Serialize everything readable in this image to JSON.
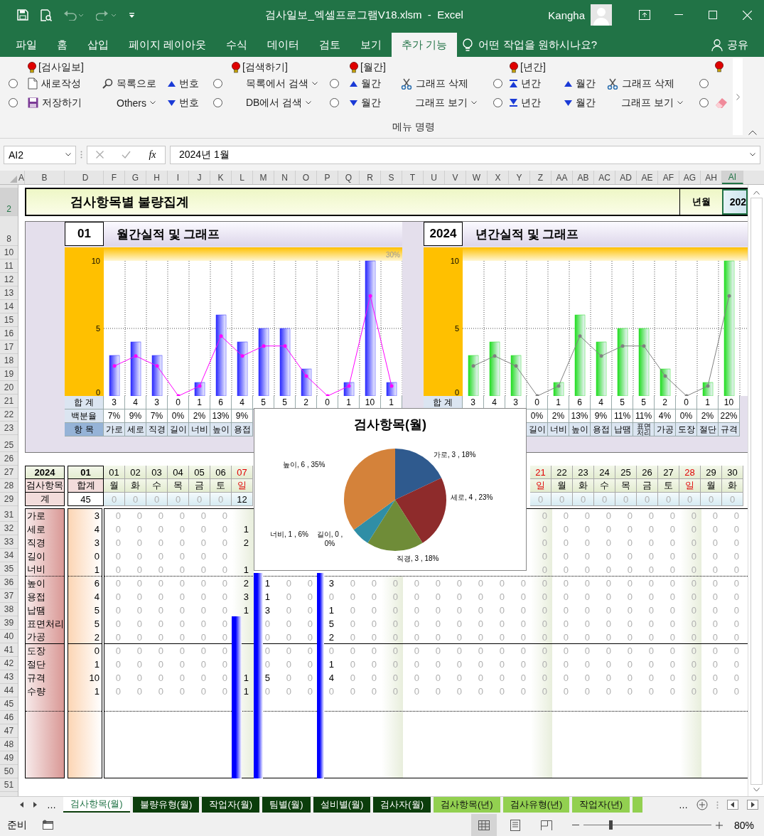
{
  "title_bar": {
    "title": "검사일보_엑셀프로그램V18.xlsm  -  Excel",
    "user": "Kangha"
  },
  "menu_tabs": [
    {
      "label": "파일",
      "selected": false
    },
    {
      "label": "홈",
      "selected": false
    },
    {
      "label": "삽입",
      "selected": false
    },
    {
      "label": "페이지 레이아웃",
      "selected": false
    },
    {
      "label": "수식",
      "selected": false
    },
    {
      "label": "데이터",
      "selected": false
    },
    {
      "label": "검토",
      "selected": false
    },
    {
      "label": "보기",
      "selected": false
    },
    {
      "label": "추가 기능",
      "selected": true
    }
  ],
  "tell_me": "어떤 작업을 원하시나요?",
  "share": "공유",
  "ribbon": {
    "group_label": "메뉴 명령",
    "columns": [
      {
        "controls": [
          {
            "kind": "radio",
            "selected": false
          },
          {
            "kind": "radio",
            "selected": false
          }
        ]
      },
      {
        "header": "[검사일보]",
        "header_icon": true,
        "controls": [
          {
            "kind": "new",
            "label": "새로작성"
          },
          {
            "kind": "save",
            "label": "저장하기"
          }
        ]
      },
      {
        "controls": [
          {
            "kind": "list",
            "label": "목록으로"
          },
          {
            "kind": "menu",
            "label": "Others"
          }
        ]
      },
      {
        "controls": [
          {
            "kind": "up",
            "label": "번호"
          },
          {
            "kind": "down",
            "label": "번호"
          }
        ]
      },
      {
        "controls": [
          {
            "kind": "radio",
            "selected": false
          },
          {
            "kind": "radio",
            "selected": false
          }
        ]
      },
      {
        "header": "[검색하기]",
        "header_icon": true,
        "controls": [
          {
            "kind": "menu",
            "label": "목록에서 검색"
          },
          {
            "kind": "menu",
            "label": "DB에서 검색"
          }
        ]
      },
      {
        "controls": [
          {
            "kind": "radio",
            "selected": false
          },
          {
            "kind": "radio",
            "selected": false
          }
        ]
      },
      {
        "header": "[월간]",
        "header_icon": true,
        "controls": [
          {
            "kind": "up",
            "label": "월간"
          },
          {
            "kind": "down",
            "label": "월간"
          }
        ]
      },
      {
        "controls": [
          {
            "kind": "cut",
            "label": "그래프 삭제"
          },
          {
            "kind": "menu",
            "label": "그래프 보기"
          }
        ]
      },
      {
        "controls": [
          {
            "kind": "radio",
            "selected": false
          },
          {
            "kind": "radio",
            "selected": false
          }
        ]
      },
      {
        "header": "[년간]",
        "header_icon": true,
        "controls": [
          {
            "kind": "first",
            "label": "년간"
          },
          {
            "kind": "last",
            "label": "년간"
          }
        ]
      },
      {
        "controls": [
          {
            "kind": "up",
            "label": "월간"
          },
          {
            "kind": "down",
            "label": "월간"
          }
        ]
      },
      {
        "controls": [
          {
            "kind": "cut",
            "label": "그래프 삭제"
          },
          {
            "kind": "menu",
            "label": "그래프 보기"
          }
        ]
      },
      {
        "controls": [
          {
            "kind": "radio",
            "selected": false
          },
          {
            "kind": "radio",
            "selected": false
          }
        ]
      },
      {
        "header_icon": true,
        "controls": [
          {
            "kind": "clear"
          }
        ]
      }
    ]
  },
  "formula_bar": {
    "name_box": "AI2",
    "function_label": "fx",
    "value": "2024년 1월"
  },
  "column_headers": [
    {
      "label": "A",
      "selected": false
    },
    {
      "label": "B",
      "selected": false
    },
    {
      "label": "D",
      "selected": false
    },
    {
      "label": "F",
      "selected": false
    },
    {
      "label": "G",
      "selected": false
    },
    {
      "label": "H",
      "selected": false
    },
    {
      "label": "I",
      "selected": false
    },
    {
      "label": "J",
      "selected": false
    },
    {
      "label": "K",
      "selected": false
    },
    {
      "label": "L",
      "selected": false
    },
    {
      "label": "M",
      "selected": false
    },
    {
      "label": "N",
      "selected": false
    },
    {
      "label": "O",
      "selected": false
    },
    {
      "label": "P",
      "selected": false
    },
    {
      "label": "Q",
      "selected": false
    },
    {
      "label": "R",
      "selected": false
    },
    {
      "label": "S",
      "selected": false
    },
    {
      "label": "T",
      "selected": false
    },
    {
      "label": "U",
      "selected": false
    },
    {
      "label": "V",
      "selected": false
    },
    {
      "label": "W",
      "selected": false
    },
    {
      "label": "X",
      "selected": false
    },
    {
      "label": "Y",
      "selected": false
    },
    {
      "label": "Z",
      "selected": false
    },
    {
      "label": "AA",
      "selected": false
    },
    {
      "label": "AB",
      "selected": false
    },
    {
      "label": "AC",
      "selected": false
    },
    {
      "label": "AD",
      "selected": false
    },
    {
      "label": "AE",
      "selected": false
    },
    {
      "label": "AF",
      "selected": false
    },
    {
      "label": "AG",
      "selected": false
    },
    {
      "label": "AH",
      "selected": false
    },
    {
      "label": "AI",
      "selected": true
    }
  ],
  "row_headers": [
    {
      "label": "2",
      "selected": true
    },
    {
      "label": "8",
      "selected": false
    },
    {
      "label": "10",
      "selected": false
    },
    {
      "label": "11",
      "selected": false
    },
    {
      "label": "12",
      "selected": false
    },
    {
      "label": "13",
      "selected": false
    },
    {
      "label": "14",
      "selected": false
    },
    {
      "label": "15",
      "selected": false
    },
    {
      "label": "16",
      "selected": false
    },
    {
      "label": "17",
      "selected": false
    },
    {
      "label": "18",
      "selected": false
    },
    {
      "label": "19",
      "selected": false
    },
    {
      "label": "20",
      "selected": false
    },
    {
      "label": "21",
      "selected": false
    },
    {
      "label": "22",
      "selected": false
    },
    {
      "label": "23",
      "selected": false
    },
    {
      "label": "25",
      "selected": false
    },
    {
      "label": "26",
      "selected": false
    },
    {
      "label": "27",
      "selected": false
    },
    {
      "label": "28",
      "selected": false
    },
    {
      "label": "29",
      "selected": false
    },
    {
      "label": "31",
      "selected": false
    },
    {
      "label": "32",
      "selected": false
    },
    {
      "label": "33",
      "selected": false
    },
    {
      "label": "34",
      "selected": false
    },
    {
      "label": "35",
      "selected": false
    },
    {
      "label": "36",
      "selected": false
    },
    {
      "label": "37",
      "selected": false
    },
    {
      "label": "38",
      "selected": false
    },
    {
      "label": "39",
      "selected": false
    },
    {
      "label": "40",
      "selected": false
    },
    {
      "label": "41",
      "selected": false
    },
    {
      "label": "42",
      "selected": false
    },
    {
      "label": "43",
      "selected": false
    },
    {
      "label": "44",
      "selected": false
    },
    {
      "label": "45",
      "selected": false
    },
    {
      "label": "46",
      "selected": false
    },
    {
      "label": "47",
      "selected": false
    },
    {
      "label": "48",
      "selected": false
    },
    {
      "label": "49",
      "selected": false
    },
    {
      "label": "50",
      "selected": false
    },
    {
      "label": "51",
      "selected": false
    }
  ],
  "banner": {
    "title": "검사항목별 불량집계",
    "period_label": "년월",
    "period_value": "202"
  },
  "monthly": {
    "period": "01",
    "title": "월간실적 및 그래프",
    "chart_data": {
      "type": "bar",
      "ylim": [
        0,
        10
      ],
      "yticks": [
        0,
        5,
        10
      ],
      "grid": true,
      "annotations": [
        {
          "text": "30%"
        }
      ],
      "series": [
        {
          "type": "bar",
          "color": "#2a2aff",
          "values": [
            3,
            4,
            3,
            0,
            1,
            6,
            4,
            5,
            5,
            2,
            0,
            1,
            10,
            1
          ]
        },
        {
          "type": "line",
          "color": "#ff00ff",
          "values": [
            2.22,
            2.96,
            2.22,
            0,
            0.74,
            4.44,
            2.96,
            3.7,
            3.7,
            1.48,
            0,
            0.74,
            7.41,
            0.74
          ]
        }
      ]
    },
    "rows": [
      {
        "label": "합 계",
        "cells": [
          "3",
          "4",
          "3",
          "0",
          "1",
          "6",
          "4",
          "5",
          "5",
          "2",
          "0",
          "1",
          "10",
          "1"
        ]
      },
      {
        "label": "백분율",
        "cells": [
          "7%",
          "9%",
          "7%",
          "0%",
          "2%",
          "13%",
          "9%",
          null,
          null,
          null,
          null,
          null,
          null,
          null
        ]
      },
      {
        "label": "항 목",
        "cells": [
          "가로",
          "세로",
          "직경",
          "길이",
          "너비",
          "높이",
          "용접",
          null,
          null,
          null,
          null,
          null,
          null,
          null
        ]
      }
    ]
  },
  "yearly": {
    "period": "2024",
    "title": "년간실적 및 그래프",
    "chart_data": {
      "type": "bar",
      "ylim": [
        0,
        10
      ],
      "yticks": [
        0,
        5,
        10
      ],
      "grid": true,
      "series": [
        {
          "type": "bar",
          "color": "#22dd22",
          "values": [
            3,
            4,
            3,
            0,
            1,
            6,
            4,
            5,
            5,
            2,
            0,
            1,
            10
          ]
        },
        {
          "type": "line",
          "color": "#808080",
          "values": [
            2.22,
            2.96,
            2.22,
            0,
            0.74,
            4.44,
            2.96,
            3.7,
            3.7,
            1.48,
            0,
            0.74,
            7.41
          ]
        }
      ]
    },
    "rows": [
      {
        "label": "합 계",
        "cells": [
          "3",
          "4",
          "3",
          "0",
          "1",
          "6",
          "4",
          "5",
          "5",
          "2",
          "0",
          "1",
          "10",
          null
        ]
      },
      {
        "cells": [
          null,
          null,
          null,
          "0%",
          "2%",
          "13%",
          "9%",
          "11%",
          "11%",
          "4%",
          "0%",
          "2%",
          "22%",
          null
        ]
      },
      {
        "cells": [
          null,
          null,
          null,
          "길이",
          "너비",
          "높이",
          "용접",
          "납땜",
          "표면처리",
          "가공",
          "도장",
          "절단",
          "규격",
          null
        ]
      }
    ]
  },
  "pie": {
    "chart_data": {
      "type": "pie",
      "title": "검사항목(월)",
      "series": [
        {
          "values": [
            18,
            23,
            18,
            0,
            6,
            35
          ]
        }
      ],
      "colors": [
        "#2f5a8e",
        "#8e2b2b",
        "#6f8c38",
        "#4c3a6e",
        "#2f8ea6",
        "#d4823a"
      ],
      "value_labels": [
        "가로, 3 , 18%",
        "세로, 4 , 23%",
        "직경, 3 , 18%",
        "길이, 0 , 0%",
        "너비, 1 , 6%",
        "높이, 6 , 35%"
      ]
    }
  },
  "daily": {
    "year": "2024",
    "month": "01",
    "item_header": "검사항목",
    "total_header": "합계",
    "sum_label": "계",
    "grand_total": "45",
    "days": [
      {
        "day": "01",
        "weekday": "월",
        "holiday": false,
        "total": "0"
      },
      {
        "day": "02",
        "weekday": "화",
        "holiday": false,
        "total": "0"
      },
      {
        "day": "03",
        "weekday": "수",
        "holiday": false,
        "total": "0"
      },
      {
        "day": "04",
        "weekday": "목",
        "holiday": false,
        "total": "0"
      },
      {
        "day": "05",
        "weekday": "금",
        "holiday": false,
        "total": "0"
      },
      {
        "day": "06",
        "weekday": "토",
        "holiday": false,
        "total": "0"
      },
      {
        "day": "07",
        "weekday": "일",
        "holiday": true,
        "total": "12"
      },
      {
        "holiday": false
      },
      {
        "holiday": false
      },
      {
        "holiday": false
      },
      {
        "holiday": false
      },
      {
        "holiday": false
      },
      {
        "holiday": false
      },
      {
        "holiday": true
      },
      {
        "holiday": false
      },
      {
        "holiday": false
      },
      {
        "holiday": false
      },
      {
        "holiday": false
      },
      {
        "holiday": false
      },
      {
        "holiday": false
      },
      {
        "day": "21",
        "weekday": "일",
        "holiday": true,
        "total": "0"
      },
      {
        "day": "22",
        "weekday": "월",
        "holiday": false,
        "total": "0"
      },
      {
        "day": "23",
        "weekday": "화",
        "holiday": false,
        "total": "0"
      },
      {
        "day": "24",
        "weekday": "수",
        "holiday": false,
        "total": "0"
      },
      {
        "day": "25",
        "weekday": "목",
        "holiday": false,
        "total": "0"
      },
      {
        "day": "26",
        "weekday": "금",
        "holiday": false,
        "total": "0"
      },
      {
        "day": "27",
        "weekday": "토",
        "holiday": false,
        "total": "0"
      },
      {
        "day": "28",
        "weekday": "일",
        "holiday": true,
        "total": "0"
      },
      {
        "day": "29",
        "weekday": "월",
        "holiday": false,
        "total": "0"
      },
      {
        "day": "30",
        "weekday": "화",
        "holiday": false,
        "total": "0"
      }
    ],
    "rows": [
      {
        "item": "가로",
        "total": "3",
        "cells": [
          "0",
          "0",
          "0",
          "0",
          "0",
          "0",
          null,
          null,
          null,
          null,
          null,
          null,
          null,
          null,
          null,
          null,
          null,
          null,
          null,
          null,
          "0",
          "0",
          "0",
          "0",
          "0",
          "0",
          "0",
          "0",
          "0",
          "0"
        ]
      },
      {
        "item": "세로",
        "total": "4",
        "cells": [
          "0",
          "0",
          "0",
          "0",
          "0",
          "0",
          "1",
          null,
          null,
          null,
          null,
          null,
          null,
          null,
          null,
          null,
          null,
          null,
          null,
          null,
          "0",
          "0",
          "0",
          "0",
          "0",
          "0",
          "0",
          "0",
          "0",
          "0"
        ]
      },
      {
        "item": "직경",
        "total": "3",
        "cells": [
          "0",
          "0",
          "0",
          "0",
          "0",
          "0",
          "2",
          null,
          null,
          null,
          null,
          null,
          null,
          null,
          null,
          null,
          null,
          null,
          null,
          null,
          "0",
          "0",
          "0",
          "0",
          "0",
          "0",
          "0",
          "0",
          "0",
          "0"
        ]
      },
      {
        "item": "길이",
        "total": "0",
        "cells": [
          "0",
          "0",
          "0",
          "0",
          "0",
          "0",
          null,
          null,
          null,
          null,
          null,
          null,
          null,
          null,
          null,
          null,
          null,
          null,
          null,
          null,
          "0",
          "0",
          "0",
          "0",
          "0",
          "0",
          "0",
          "0",
          "0",
          "0"
        ]
      },
      {
        "item": "너비",
        "total": "1",
        "cells": [
          "0",
          "0",
          "0",
          "0",
          "0",
          "0",
          "1",
          null,
          null,
          null,
          null,
          null,
          null,
          null,
          null,
          null,
          null,
          null,
          null,
          null,
          "0",
          "0",
          "0",
          "0",
          "0",
          "0",
          "0",
          "0",
          "0",
          "0"
        ]
      },
      {
        "item": "높이",
        "total": "6",
        "cells": [
          "0",
          "0",
          "0",
          "0",
          "0",
          "0",
          "2",
          "1",
          "0",
          "0",
          "3",
          "0",
          "0",
          "0",
          "0",
          "0",
          "0",
          "0",
          "0",
          "0",
          "0",
          "0",
          "0",
          "0",
          "0",
          "0",
          "0",
          "0",
          "0",
          "0"
        ]
      },
      {
        "item": "용접",
        "total": "4",
        "cells": [
          "0",
          "0",
          "0",
          "0",
          "0",
          "0",
          "3",
          "1",
          "0",
          "0",
          "0",
          "0",
          "0",
          "0",
          "0",
          "0",
          "0",
          "0",
          "0",
          "0",
          "0",
          "0",
          "0",
          "0",
          "0",
          "0",
          "0",
          "0",
          "0",
          "0"
        ]
      },
      {
        "item": "납땜",
        "total": "5",
        "cells": [
          "0",
          "0",
          "0",
          "0",
          "0",
          "0",
          "1",
          "3",
          "0",
          "0",
          "1",
          "0",
          "0",
          "0",
          "0",
          "0",
          "0",
          "0",
          "0",
          "0",
          "0",
          "0",
          "0",
          "0",
          "0",
          "0",
          "0",
          "0",
          "0",
          "0"
        ]
      },
      {
        "item": "표면처리",
        "total": "5",
        "cells": [
          "0",
          "0",
          "0",
          "0",
          "0",
          "0",
          null,
          "0",
          "0",
          "0",
          "5",
          "0",
          "0",
          "0",
          "0",
          "0",
          "0",
          "0",
          "0",
          "0",
          "0",
          "0",
          "0",
          "0",
          "0",
          "0",
          "0",
          "0",
          "0",
          "0"
        ]
      },
      {
        "item": "가공",
        "total": "2",
        "cells": [
          "0",
          "0",
          "0",
          "0",
          "0",
          "0",
          null,
          "0",
          "0",
          "0",
          "2",
          "0",
          "0",
          "0",
          "0",
          "0",
          "0",
          "0",
          "0",
          "0",
          "0",
          "0",
          "0",
          "0",
          "0",
          "0",
          "0",
          "0",
          "0",
          "0"
        ]
      },
      {
        "item": "도장",
        "total": "0",
        "cells": [
          "0",
          "0",
          "0",
          "0",
          "0",
          "0",
          null,
          "0",
          "0",
          "0",
          "0",
          "0",
          "0",
          "0",
          "0",
          "0",
          "0",
          "0",
          "0",
          "0",
          "0",
          "0",
          "0",
          "0",
          "0",
          "0",
          "0",
          "0",
          "0",
          "0"
        ]
      },
      {
        "item": "절단",
        "total": "1",
        "cells": [
          "0",
          "0",
          "0",
          "0",
          "0",
          "0",
          null,
          "0",
          "0",
          "0",
          "1",
          "0",
          "0",
          "0",
          "0",
          "0",
          "0",
          "0",
          "0",
          "0",
          "0",
          "0",
          "0",
          "0",
          "0",
          "0",
          "0",
          "0",
          "0",
          "0"
        ]
      },
      {
        "item": "규격",
        "total": "10",
        "cells": [
          "0",
          "0",
          "0",
          "0",
          "0",
          "0",
          "1",
          "5",
          "0",
          "0",
          "4",
          "0",
          "0",
          "0",
          "0",
          "0",
          "0",
          "0",
          "0",
          "0",
          "0",
          "0",
          "0",
          "0",
          "0",
          "0",
          "0",
          "0",
          "0",
          "0"
        ]
      },
      {
        "item": "수량",
        "total": "1",
        "cells": [
          "0",
          "0",
          "0",
          "0",
          "0",
          "0",
          "1",
          "0",
          "0",
          "0",
          "0",
          "0",
          "0",
          "0",
          "0",
          "0",
          "0",
          "0",
          "0",
          "0",
          "0",
          "0",
          "0",
          "0",
          "0",
          "0",
          "0",
          "0",
          "0",
          "0"
        ]
      }
    ]
  },
  "sheet_tabs": {
    "more_left": "…",
    "more_right": "…",
    "tabs": [
      {
        "label": "검사항목(월)",
        "selected": true,
        "color": "#0b3d0b"
      },
      {
        "label": "불량유형(월)",
        "selected": false,
        "color": "#0b3d0b"
      },
      {
        "label": "작업자(월)",
        "selected": false,
        "color": "#0b3d0b"
      },
      {
        "label": "팀별(월)",
        "selected": false,
        "color": "#0b3d0b"
      },
      {
        "label": "설비별(월)",
        "selected": false,
        "color": "#0b3d0b"
      },
      {
        "label": "검사자(월)",
        "selected": false,
        "color": "#0b3d0b"
      },
      {
        "label": "검사항목(년)",
        "selected": false,
        "color": "#92d050"
      },
      {
        "label": "검사유형(년)",
        "selected": false,
        "color": "#92d050"
      },
      {
        "label": "작업자(년)",
        "selected": false,
        "color": "#92d050"
      },
      {
        "selected": false,
        "color": "#92d050"
      }
    ]
  },
  "status_bar": {
    "text": "준비",
    "views": [
      {
        "kind": "normal",
        "selected": true
      },
      {
        "kind": "page",
        "selected": false
      },
      {
        "kind": "break",
        "selected": false
      }
    ],
    "zoom": {
      "level": 0.21,
      "reading": "80%"
    }
  }
}
